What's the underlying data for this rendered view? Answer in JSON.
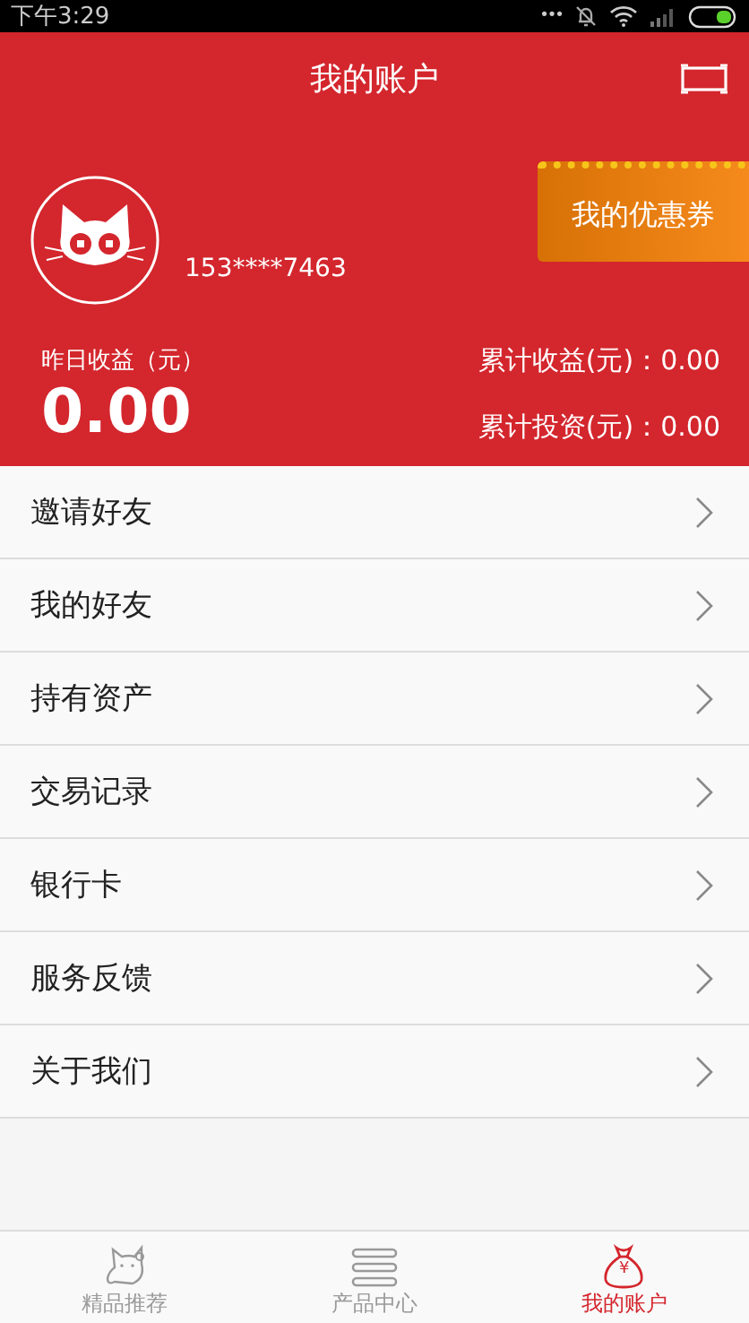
{
  "status_bar": {
    "time": "下午3:29",
    "dots": "•••"
  },
  "header": {
    "title": "我的账户"
  },
  "profile": {
    "phone": "153****7463",
    "coupon_button": "我的优惠券"
  },
  "stats": {
    "yesterday_label": "昨日收益（元）",
    "yesterday_value": "0.00",
    "totals": [
      {
        "label": "累计收益(元)：0.00"
      },
      {
        "label": "累计投资(元)：0.00"
      }
    ]
  },
  "menu": [
    {
      "label": "邀请好友"
    },
    {
      "label": "我的好友"
    },
    {
      "label": "持有资产"
    },
    {
      "label": "交易记录"
    },
    {
      "label": "银行卡"
    },
    {
      "label": "服务反馈"
    },
    {
      "label": "关于我们"
    }
  ],
  "tabs": [
    {
      "label": "精品推荐",
      "kind": "cat",
      "selected": false
    },
    {
      "label": "产品中心",
      "kind": "list",
      "selected": false
    },
    {
      "label": "我的账户",
      "kind": "bag",
      "selected": true,
      "icon_text": "¥"
    }
  ]
}
